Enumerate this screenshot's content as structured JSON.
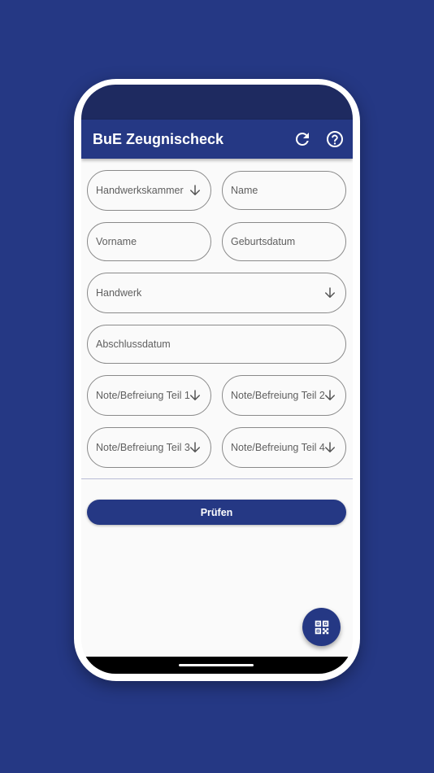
{
  "app_bar": {
    "title": "BuE Zeugnischeck",
    "refresh_icon": "refresh-icon",
    "help_icon": "help-circle-icon"
  },
  "form": {
    "handwerkskammer": "Handwerkskammer",
    "name": "Name",
    "vorname": "Vorname",
    "geburtsdatum": "Geburtsdatum",
    "handwerk": "Handwerk",
    "abschlussdatum": "Abschlussdatum",
    "note_teil_1": "Note/Befreiung Teil 1",
    "note_teil_2": "Note/Befreiung Teil 2",
    "note_teil_3": "Note/Befreiung Teil 3",
    "note_teil_4": "Note/Befreiung Teil 4"
  },
  "submit_label": "Prüfen",
  "fab_icon": "qr-code-scan-icon",
  "colors": {
    "background": "#253884",
    "primary": "#253884",
    "status_bar": "#1e2a60",
    "surface": "#fafafa"
  }
}
